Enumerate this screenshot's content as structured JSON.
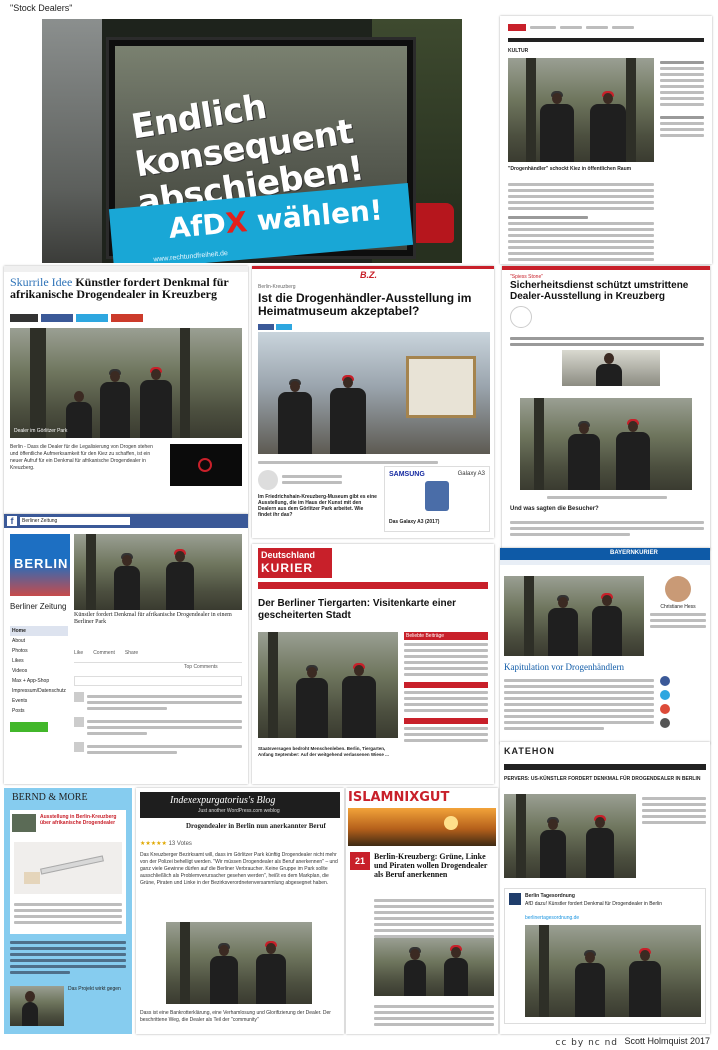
{
  "page": {
    "caption": "\"Stock Dealers\"",
    "credit": "Scott Holmquist 2017",
    "license_mark": "cc by nc nd"
  },
  "poster": {
    "line1": "Endlich",
    "line2": "konsequent",
    "line3": "abschieben!",
    "afd_prefix": "AfD",
    "afd_x": "X",
    "afd_suffix": "wählen!",
    "url": "www.rechtundfreiheit.de"
  },
  "tagesspiegel": {
    "section": "KULTUR",
    "headline": "\"Drogenhändler\" schockt Kiez in öffentlichen Raum"
  },
  "berliner_zeitung": {
    "kicker": "Skurrile Idee",
    "headline": "Künstler fordert Denkmal für afrikanische Drogendealer in Kreuzberg",
    "caption": "Dealer im Görlitzer Park",
    "lead": "Berlin - Dass die Dealer für die Legalisierung von Drogen stehen und öffentliche Aufmerksamkeit für den Kiez zu schaffen, ist ein neuer Aufruf für ein Denkmal für afrikanische Drogendealer in Kreuzberg."
  },
  "bz": {
    "logo": "B.Z.",
    "kicker": "Berlin-Kreuzberg",
    "headline": "Ist die Drogenhändler-Ausstellung im Heimatmuseum akzeptabel?",
    "teaser": "Im Friedrichshain-Kreuzberg-Museum gibt es eine Ausstellung, die im Haus der Kunst mit den Dealern aus dem Görlitzer Park arbeitet. Wie findet ihr das?",
    "ad_brand": "SAMSUNG",
    "ad_product": "Galaxy A3",
    "ad_offer": "Das Galaxy A3 (2017)"
  },
  "security": {
    "kicker": "\"Spiess Stone\"",
    "headline": "Sicherheitsdienst schützt umstrittene Dealer-Ausstellung in Kreuzberg",
    "question": "Und was sagten die Besucher?"
  },
  "facebook": {
    "page_name": "Berliner Zeitung",
    "page_title": "Berliner Zeitung",
    "logo_text": "BERLIN",
    "post_title": "Künstler fordert Denkmal für afrikanische Drogendealer in einem Berliner Park",
    "nav": [
      "Home",
      "About",
      "Photos",
      "Likes",
      "Videos",
      "Max + App-Shop",
      "Impressum/Datenschutz",
      "Events",
      "Posts"
    ],
    "actions": [
      "Like",
      "Comment",
      "Share"
    ],
    "top_comments": "Top Comments"
  },
  "deutschland_kurier": {
    "logo1": "Deutschland",
    "logo2": "KURIER",
    "headline": "Der Berliner Tiergarten: Visitenkarte einer gescheiterten Stadt",
    "teaser": "Staatsversagen bedroht Menschenleben. Berlin, Tiergarten, Anfang September: Auf der weitgehend verlassenen Wiese ...",
    "sidebar_title": "Beliebte Beiträge"
  },
  "bayernkurier": {
    "logo": "BAYERNKURIER",
    "headline": "Kapitulation vor Drogenhändlern",
    "author": "Christiane Hess"
  },
  "katehon": {
    "logo": "KATEHON",
    "headline": "PERVERS: US-KÜNSTLER FORDERT DENKMAL FÜR DROGENDEALER IN BERLIN",
    "tweet_author": "Berlin Tagesordnung",
    "tweet_text": "AfD dazu! Künstler fordert Denkmal für Drogendealer in Berlin",
    "tweet_link": "berlinertagesordnung.de"
  },
  "bernd": {
    "logo": "BERND & MORE",
    "headline": "Ausstellung in Berlin-Kreuzberg über afrikanische Drogendealer",
    "sub": "Das Projekt wirkt gegen"
  },
  "index_blog": {
    "title": "Indexexpurgatorius's Blog",
    "subtitle": "Just another WordPress.com weblog",
    "headline": "Drogendealer in Berlin nun anerkannter Beruf",
    "votes": "13 Votes",
    "body1": "Das Kreuzberger Bezirksamt will, dass im Görlitzer Park künftig Drogendealer nicht mehr von der Polizei behelligt werden. \"Wir müssen Drogendealer als Beruf anerkennen\" – und ganz viele Gewinne dürfen auf die Berliner Verbraucher. Keine Gruppe im Park sollte ausschließlich als Problemverursacher gesehen werden\", heißt es dem Markplan, die Grüne, Piraten und Linke in der Bezirksverordnetenversammlung abgesegnet haben.",
    "body2": "Dass ist eine Bankrotterklärung, eine Verhamlosung und Glorifizierung der Dealer. Der beschrittene Weg, die Dealer als Teil der \"community\""
  },
  "islamnixgut": {
    "logo": "ISLAMNIXGUT",
    "date_day": "21",
    "headline": "Berlin-Kreuzberg: Grüne, Linke und Piraten wollen Drogendealer als Beruf anerkennen"
  }
}
